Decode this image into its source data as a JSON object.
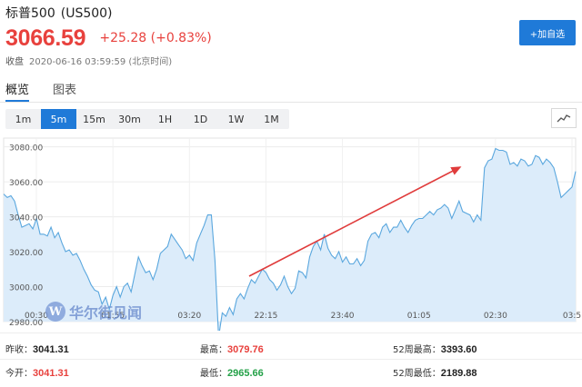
{
  "header": {
    "name": "标普500",
    "code": "(US500)",
    "price": "3066.59",
    "change": "+25.28 (+0.83%)",
    "status_label": "收盘",
    "timestamp": "2020-06-16 03:59:59 (北京时间)",
    "add_button": "+加自选"
  },
  "tabs": [
    {
      "label": "概览",
      "active": true
    },
    {
      "label": "图表",
      "active": false
    }
  ],
  "periods": [
    {
      "label": "1m",
      "active": false
    },
    {
      "label": "5m",
      "active": true
    },
    {
      "label": "15m",
      "active": false
    },
    {
      "label": "30m",
      "active": false
    },
    {
      "label": "1H",
      "active": false
    },
    {
      "label": "1D",
      "active": false
    },
    {
      "label": "1W",
      "active": false
    },
    {
      "label": "1M",
      "active": false
    }
  ],
  "chart_toggle_icon": "line-chart-icon",
  "watermark": {
    "logo": "W",
    "text": "华尔街见闻"
  },
  "colors": {
    "accent": "#1f7ad8",
    "up": "#e8413d",
    "down": "#24a148",
    "line": "#5aa7de",
    "fill": "#dcecfa",
    "arrow": "#e03c3c"
  },
  "chart_data": {
    "type": "area",
    "ylim": [
      2980,
      3085
    ],
    "y_ticks": [
      "3080.00",
      "3060.00",
      "3040.00",
      "3020.00",
      "3000.00",
      "2980.00"
    ],
    "x_ticks": [
      "00:30",
      "01:55",
      "03:20",
      "22:15",
      "23:40",
      "01:05",
      "02:30",
      "03:5"
    ],
    "values": [
      3053,
      3051,
      3052,
      3049,
      3041,
      3034,
      3035,
      3036,
      3033,
      3039,
      3030,
      3030,
      3029,
      3034,
      3028,
      3031,
      3025,
      3020,
      3021,
      3018,
      3019,
      3015,
      3010,
      3006,
      3001,
      2998,
      2997,
      2990,
      2994,
      2987,
      2995,
      3000,
      2994,
      3000,
      3002,
      2997,
      3007,
      3017,
      3012,
      3008,
      3009,
      3004,
      3010,
      3019,
      3021,
      3023,
      3030,
      3027,
      3024,
      3021,
      3016,
      3018,
      3015,
      3025,
      3030,
      3035,
      3041,
      3041,
      3015,
      2971,
      2985,
      2983,
      2988,
      2984,
      2993,
      2996,
      2993,
      2999,
      3004,
      3002,
      3006,
      3010,
      3008,
      3004,
      3002,
      2998,
      3001,
      3006,
      3000,
      2996,
      2999,
      3009,
      3008,
      3005,
      3017,
      3023,
      3026,
      3021,
      3030,
      3022,
      3018,
      3016,
      3020,
      3014,
      3017,
      3013,
      3013,
      3016,
      3012,
      3015,
      3026,
      3030,
      3031,
      3028,
      3034,
      3036,
      3031,
      3034,
      3034,
      3038,
      3034,
      3031,
      3035,
      3038,
      3039,
      3039,
      3041,
      3043,
      3041,
      3044,
      3045,
      3047,
      3045,
      3039,
      3044,
      3049,
      3043,
      3042,
      3041,
      3037,
      3041,
      3038,
      3068,
      3072,
      3073,
      3079,
      3078,
      3078,
      3077,
      3070,
      3071,
      3069,
      3073,
      3072,
      3069,
      3070,
      3075,
      3074,
      3070,
      3073,
      3071,
      3068,
      3060,
      3051,
      3053,
      3055,
      3057,
      3066
    ]
  }
}
